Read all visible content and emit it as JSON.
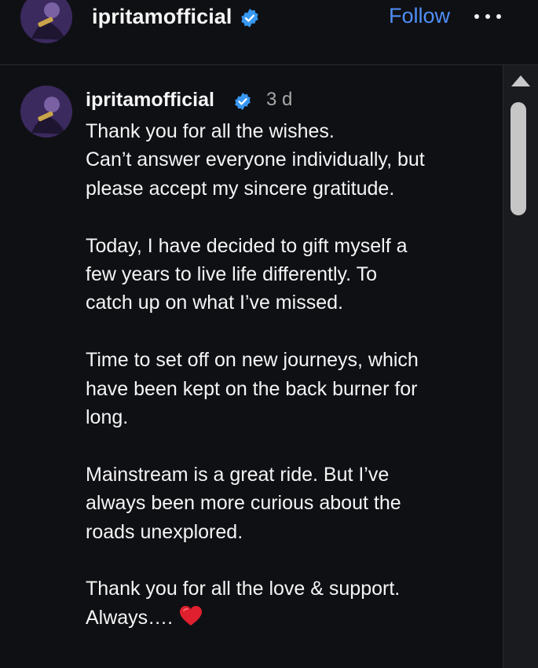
{
  "header": {
    "username": "ipritamofficial",
    "follow_label": "Follow",
    "more_icon": "more-horizontal-icon",
    "verified_icon": "verified-badge-icon"
  },
  "comment": {
    "username": "ipritamofficial",
    "timestamp": "3 d",
    "paragraphs": [
      [
        "Thank you for all the wishes.",
        "Can’t answer everyone individually, but",
        "please accept my sincere gratitude."
      ],
      [
        "Today, I have decided to gift myself a",
        "few years to live life differently. To",
        "catch up on what I’ve missed."
      ],
      [
        "Time to set off on new journeys, which",
        "have been kept on the back burner for",
        "long."
      ],
      [
        "Mainstream is a great ride. But I’ve",
        "always been more curious about the",
        "roads unexplored."
      ],
      [
        "Thank you for all the love & support.",
        "Always…."
      ]
    ],
    "emoji_icon": "red-heart-icon"
  },
  "scrollbar": {
    "up_icon": "scroll-up-arrow-icon",
    "scroll_position": 0
  },
  "colors": {
    "background": "#0f1014",
    "accent": "#4f8ff7",
    "verified": "#3897f0",
    "muted_text": "#a8a8a8",
    "heart": "#e0202e"
  }
}
